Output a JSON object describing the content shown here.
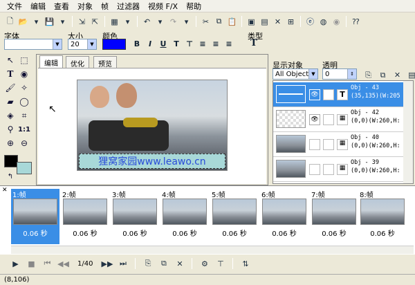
{
  "menu": [
    "文件",
    "编辑",
    "查看",
    "对象",
    "帧",
    "过滤器",
    "视频 F/X",
    "帮助"
  ],
  "font_panel": {
    "font_label": "字体",
    "size_label": "大小",
    "size_value": "20",
    "color_label": "颜色",
    "color_value": "#0000ff",
    "type_label": "类型",
    "format_buttons": [
      "B",
      "I",
      "U",
      "T"
    ]
  },
  "tabs": [
    "编辑",
    "优化",
    "预览"
  ],
  "canvas_caption": "狸窝家园www.leawo.cn",
  "objects_panel": {
    "display_label": "显示对象",
    "display_value": "All Object:",
    "opacity_label": "透明",
    "opacity_value": "0",
    "rows": [
      {
        "name": "Obj - 43",
        "info": "(35,135)(W:205"
      },
      {
        "name": "Obj - 42",
        "info": "(0,0)(W:260,H:"
      },
      {
        "name": "Obj - 40",
        "info": "(0,0)(W:260,H:"
      },
      {
        "name": "Obj - 39",
        "info": "(0,0)(W:260,H:"
      }
    ]
  },
  "frames": [
    {
      "label": "1:帧",
      "time": "0.06 秒"
    },
    {
      "label": "2:帧",
      "time": "0.06 秒"
    },
    {
      "label": "3:帧",
      "time": "0.06 秒"
    },
    {
      "label": "4:帧",
      "time": "0.06 秒"
    },
    {
      "label": "5:帧",
      "time": "0.06 秒"
    },
    {
      "label": "6:帧",
      "time": "0.06 秒"
    },
    {
      "label": "7:帧",
      "time": "0.06 秒"
    },
    {
      "label": "8:帧",
      "time": "0.06 秒"
    }
  ],
  "playbar": {
    "counter": "1/40"
  },
  "status": {
    "coords": "(8,106)"
  }
}
